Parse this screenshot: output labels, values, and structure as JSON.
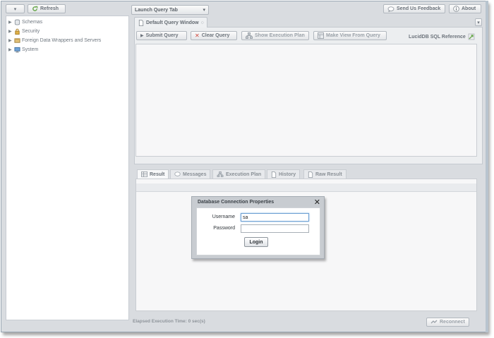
{
  "toolbar": {
    "dropdown_arrow": "▾",
    "refresh_label": "Refresh",
    "launch_query_tab_label": "Launch Query Tab",
    "feedback_label": "Send Us Feedback",
    "about_label": "About"
  },
  "tree": {
    "items": [
      {
        "label": "Schemas",
        "icon": "schemas-icon"
      },
      {
        "label": "Security",
        "icon": "security-icon"
      },
      {
        "label": "Foreign Data Wrappers and Servers",
        "icon": "foreign-data-icon"
      },
      {
        "label": "System",
        "icon": "system-icon"
      }
    ]
  },
  "query_window": {
    "tab_label": "Default Query Window",
    "tab_close": "○",
    "submit_label": "Submit Query",
    "clear_label": "Clear Query",
    "plan_label": "Show Execution Plan",
    "make_view_label": "Make View From Query",
    "reference_label": "LucidDB SQL Reference"
  },
  "result_tabs": [
    {
      "label": "Result"
    },
    {
      "label": "Messages"
    },
    {
      "label": "Execution Plan"
    },
    {
      "label": "History"
    },
    {
      "label": "Raw Result"
    }
  ],
  "status": {
    "elapsed": "Elapsed Execution Time: 0 sec(s)",
    "reconnect_label": "Reconnect"
  },
  "modal": {
    "title": "Database Connection Properties",
    "close": "✕",
    "username_label": "Username",
    "username_value": "sa",
    "password_label": "Password",
    "password_value": "",
    "login_label": "Login"
  },
  "colors": {
    "background": "#d9dce0",
    "panel": "#ffffff",
    "accent_green": "#6aa84f",
    "focus_blue": "#6da0d3"
  }
}
